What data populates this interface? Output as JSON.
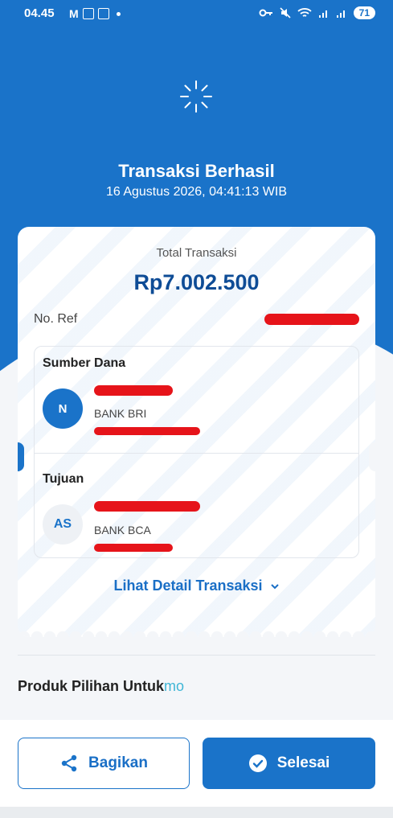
{
  "status_bar": {
    "time": "04.45",
    "battery": "71"
  },
  "header": {
    "title": "Transaksi Berhasil",
    "datetime": "16 Agustus 2026, 04:41:13 WIB"
  },
  "receipt": {
    "total_label": "Total Transaksi",
    "total_amount": "Rp7.002.500",
    "ref_label": "No. Ref",
    "source": {
      "title": "Sumber Dana",
      "avatar": "N",
      "bank": "BANK BRI"
    },
    "destination": {
      "title": "Tujuan",
      "avatar": "AS",
      "bank": "BANK BCA"
    },
    "detail_link": "Lihat Detail Transaksi"
  },
  "produk": {
    "title": "Produk Pilihan Untuk",
    "brand": "mo"
  },
  "actions": {
    "share_label": "Bagikan",
    "done_label": "Selesai"
  },
  "colors": {
    "primary": "#1a73c9",
    "redaction": "#e6141a"
  },
  "icons": [
    "sparkle-icon",
    "share-icon",
    "check-circle-icon",
    "chevron-down-icon"
  ]
}
